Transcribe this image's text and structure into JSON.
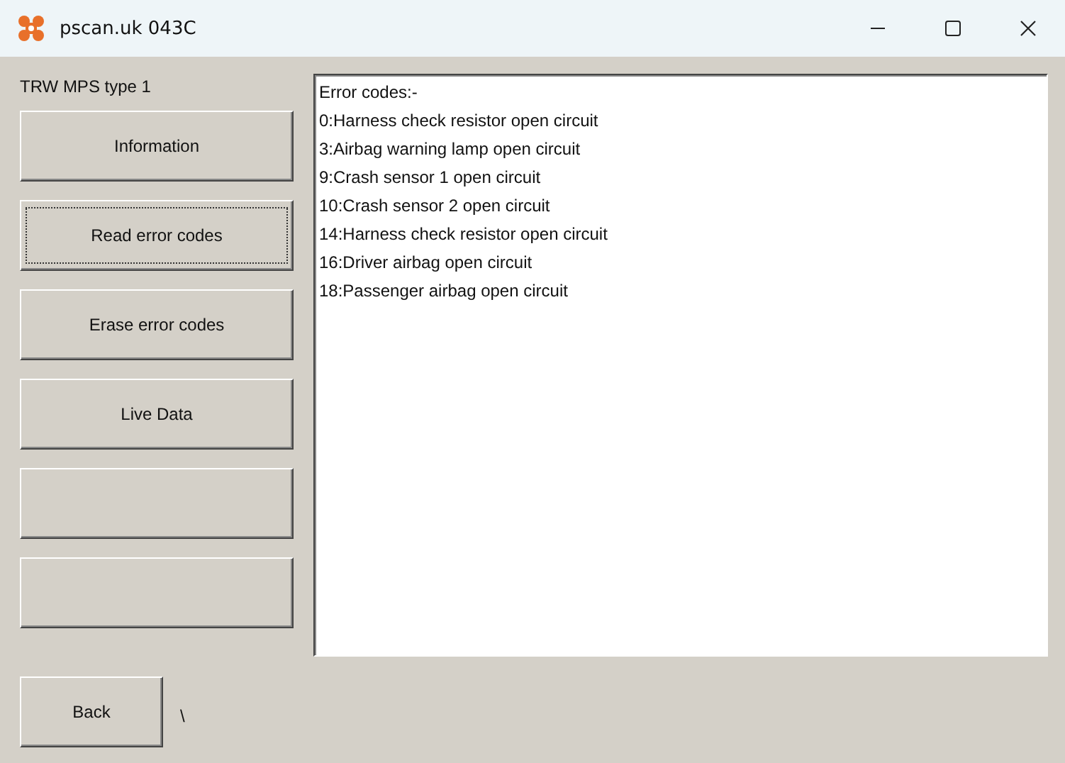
{
  "window": {
    "title": "pscan.uk 043C"
  },
  "module_label": "TRW MPS type 1",
  "buttons": [
    {
      "label": "Information",
      "focused": false
    },
    {
      "label": "Read error codes",
      "focused": true
    },
    {
      "label": "Erase error codes",
      "focused": false
    },
    {
      "label": "Live Data",
      "focused": false
    },
    {
      "focused": false
    },
    {
      "focused": false
    }
  ],
  "output_lines": [
    "Error codes:-",
    "0:Harness check resistor open circuit",
    "3:Airbag warning lamp open circuit",
    "9:Crash sensor 1 open circuit",
    "10:Crash sensor 2 open circuit",
    "14:Harness check resistor open circuit",
    "16:Driver airbag open circuit",
    "18:Passenger airbag open circuit"
  ],
  "back_button": {
    "label": "Back"
  },
  "status_text": "\\"
}
